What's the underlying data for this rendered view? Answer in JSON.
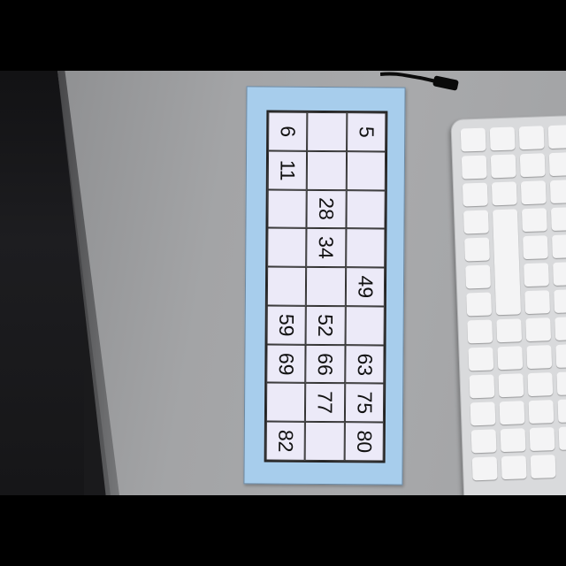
{
  "scene": {
    "description_ref": "photo",
    "card": {
      "color": "#a7cdec",
      "cells": [
        "6",
        "",
        "5",
        "11",
        "",
        "",
        "",
        "28",
        "",
        "",
        "34",
        "",
        "",
        "",
        "49",
        "59",
        "52",
        "",
        "69",
        "66",
        "63",
        "",
        "77",
        "75",
        "82",
        "",
        "80"
      ]
    },
    "keyboard": {
      "keys": [
        "",
        "",
        "",
        "",
        "",
        "",
        "",
        "",
        "",
        "",
        "",
        "",
        "",
        "",
        "",
        "",
        "",
        "",
        "",
        "",
        "",
        "",
        "",
        "",
        "",
        "",
        "",
        "",
        "",
        "",
        "",
        "",
        "",
        "",
        "",
        "",
        "",
        "",
        "",
        "",
        "",
        "",
        "",
        "",
        "",
        "",
        "",
        "",
        "",
        "",
        "",
        "",
        "",
        "",
        "",
        "",
        "",
        "",
        "",
        ""
      ]
    }
  }
}
